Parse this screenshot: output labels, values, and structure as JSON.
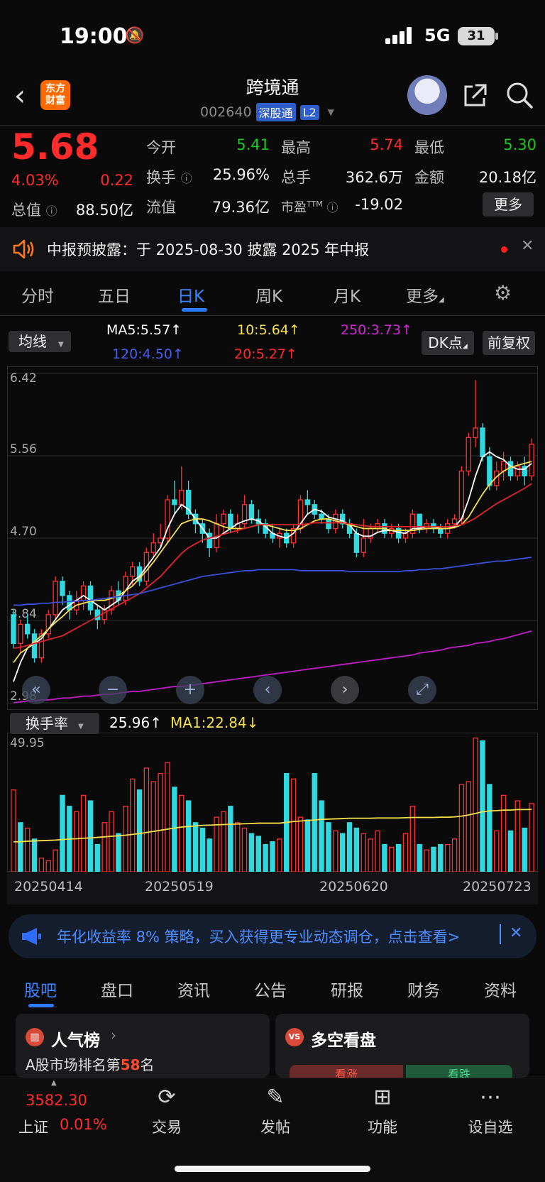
{
  "status_bar": {
    "time": "19:00",
    "network": "5G",
    "battery": "31"
  },
  "header": {
    "logo_line1": "东方",
    "logo_line2": "财富",
    "name": "跨境通",
    "code": "002640",
    "exchange_tag": "深股通",
    "level_tag": "L2"
  },
  "quote": {
    "price": "5.68",
    "change_pct": "4.03%",
    "change": "0.22",
    "fields": [
      {
        "label": "今开",
        "value": "5.41",
        "color": "#1ec81e"
      },
      {
        "label": "最高",
        "value": "5.74",
        "color": "#ff2b2b"
      },
      {
        "label": "最低",
        "value": "5.30",
        "color": "#1ec81e"
      },
      {
        "label": "换手",
        "value": "25.96%",
        "color": "#f2f2f2"
      },
      {
        "label": "总手",
        "value": "362.6万",
        "color": "#f2f2f2"
      },
      {
        "label": "金额",
        "value": "20.18亿",
        "color": "#f2f2f2"
      },
      {
        "label": "总值",
        "value": "88.50亿",
        "color": "#f2f2f2"
      },
      {
        "label": "流值",
        "value": "79.36亿",
        "color": "#f2f2f2"
      },
      {
        "label": "市盈",
        "value": "-19.02",
        "color": "#f2f2f2"
      }
    ],
    "pe_superscript": "TTM",
    "more_label": "更多"
  },
  "notice": {
    "text": "中报预披露：于 2025-08-30 披露 2025 年中报"
  },
  "period_tabs": [
    "分时",
    "五日",
    "日K",
    "周K",
    "月K",
    "更多"
  ],
  "active_period": "日K",
  "indicators": {
    "ma_selector": "均线",
    "ma5": "MA5:5.57",
    "ma10": "10:5.64",
    "ma250": "250:3.73",
    "ma120": "120:4.50",
    "ma20": "20:5.27",
    "dk_label": "DK点",
    "adjust_label": "前复权",
    "colors": {
      "ma5": "#ffffff",
      "ma10": "#f5e14a",
      "ma20": "#e0242c",
      "ma120": "#3b4fd6",
      "ma250": "#c21cc8"
    }
  },
  "chart_data": [
    {
      "type": "candlestick",
      "title": "",
      "y_ticks": [
        "6.42",
        "5.56",
        "4.70",
        "3.84",
        "2.98"
      ],
      "ylim": [
        2.98,
        6.42
      ],
      "candles": [
        [
          3.9,
          3.6,
          3.95,
          3.55
        ],
        [
          3.6,
          3.8,
          3.85,
          3.5
        ],
        [
          3.8,
          3.7,
          3.9,
          3.65
        ],
        [
          3.7,
          3.45,
          3.75,
          3.4
        ],
        [
          3.45,
          3.7,
          3.75,
          3.4
        ],
        [
          3.7,
          3.9,
          3.95,
          3.65
        ],
        [
          3.9,
          4.25,
          4.3,
          3.85
        ],
        [
          4.25,
          4.1,
          4.3,
          4.0
        ],
        [
          4.1,
          3.95,
          4.15,
          3.85
        ],
        [
          3.95,
          4.05,
          4.15,
          3.9
        ],
        [
          4.05,
          4.2,
          4.25,
          3.95
        ],
        [
          4.2,
          3.95,
          4.25,
          3.9
        ],
        [
          3.95,
          3.85,
          4.0,
          3.75
        ],
        [
          3.85,
          3.95,
          4.0,
          3.8
        ],
        [
          3.95,
          4.15,
          4.2,
          3.9
        ],
        [
          4.15,
          4.05,
          4.25,
          4.0
        ],
        [
          4.05,
          4.3,
          4.35,
          4.0
        ],
        [
          4.3,
          4.4,
          4.45,
          4.2
        ],
        [
          4.4,
          4.25,
          4.45,
          4.2
        ],
        [
          4.25,
          4.55,
          4.6,
          4.2
        ],
        [
          4.55,
          4.65,
          4.75,
          4.5
        ],
        [
          4.65,
          4.7,
          4.85,
          4.6
        ],
        [
          4.7,
          5.1,
          5.15,
          4.65
        ],
        [
          5.1,
          5.05,
          5.3,
          4.95
        ],
        [
          5.05,
          5.2,
          5.45,
          5.0
        ],
        [
          5.2,
          4.95,
          5.3,
          4.9
        ],
        [
          4.95,
          4.85,
          5.0,
          4.75
        ],
        [
          4.85,
          4.75,
          4.9,
          4.65
        ],
        [
          4.75,
          4.6,
          4.8,
          4.5
        ],
        [
          4.6,
          4.85,
          4.95,
          4.55
        ],
        [
          4.85,
          4.95,
          5.0,
          4.75
        ],
        [
          4.95,
          4.8,
          5.0,
          4.75
        ],
        [
          4.8,
          4.85,
          4.95,
          4.75
        ],
        [
          4.85,
          5.05,
          5.15,
          4.8
        ],
        [
          5.05,
          4.9,
          5.1,
          4.85
        ],
        [
          4.9,
          4.85,
          5.0,
          4.75
        ],
        [
          4.85,
          4.75,
          4.9,
          4.7
        ],
        [
          4.75,
          4.7,
          4.85,
          4.65
        ],
        [
          4.7,
          4.75,
          4.8,
          4.6
        ],
        [
          4.75,
          4.65,
          4.8,
          4.6
        ],
        [
          4.65,
          4.8,
          4.85,
          4.6
        ],
        [
          4.8,
          5.1,
          5.15,
          4.75
        ],
        [
          5.1,
          5.05,
          5.2,
          4.95
        ],
        [
          5.05,
          4.95,
          5.1,
          4.9
        ],
        [
          4.95,
          4.9,
          5.0,
          4.85
        ],
        [
          4.9,
          4.8,
          4.95,
          4.75
        ],
        [
          4.8,
          4.95,
          5.0,
          4.75
        ],
        [
          4.95,
          4.85,
          5.0,
          4.8
        ],
        [
          4.85,
          4.75,
          4.9,
          4.7
        ],
        [
          4.75,
          4.55,
          4.8,
          4.5
        ],
        [
          4.55,
          4.7,
          4.9,
          4.5
        ],
        [
          4.7,
          4.8,
          4.85,
          4.65
        ],
        [
          4.8,
          4.85,
          4.9,
          4.75
        ],
        [
          4.85,
          4.75,
          4.9,
          4.7
        ],
        [
          4.75,
          4.8,
          4.85,
          4.7
        ],
        [
          4.8,
          4.7,
          4.85,
          4.65
        ],
        [
          4.7,
          4.75,
          4.8,
          4.65
        ],
        [
          4.75,
          4.95,
          5.0,
          4.7
        ],
        [
          4.95,
          4.8,
          4.95,
          4.75
        ],
        [
          4.8,
          4.85,
          4.9,
          4.75
        ],
        [
          4.85,
          4.8,
          4.9,
          4.75
        ],
        [
          4.8,
          4.75,
          4.85,
          4.7
        ],
        [
          4.75,
          4.85,
          4.9,
          4.7
        ],
        [
          4.85,
          4.9,
          4.95,
          4.8
        ],
        [
          4.9,
          5.4,
          5.45,
          4.85
        ],
        [
          5.4,
          5.75,
          5.8,
          5.35
        ],
        [
          5.75,
          5.85,
          6.35,
          5.65
        ],
        [
          5.85,
          5.55,
          5.9,
          5.5
        ],
        [
          5.55,
          5.25,
          5.65,
          5.2
        ],
        [
          5.25,
          5.4,
          5.5,
          5.2
        ],
        [
          5.4,
          5.5,
          5.6,
          5.3
        ],
        [
          5.5,
          5.35,
          5.55,
          5.3
        ],
        [
          5.35,
          5.45,
          5.5,
          5.3
        ],
        [
          5.45,
          5.35,
          5.55,
          5.25
        ],
        [
          5.35,
          5.68,
          5.74,
          5.3
        ]
      ],
      "series": [
        {
          "name": "MA5",
          "color": "#ffffff",
          "values": [
            3.2,
            3.4,
            3.55,
            3.6,
            3.65,
            3.75,
            3.85,
            3.95,
            4.0,
            4.05,
            4.1,
            4.05,
            4.0,
            3.95,
            4.0,
            4.05,
            4.15,
            4.25,
            4.3,
            4.4,
            4.5,
            4.6,
            4.8,
            4.95,
            5.05,
            5.0,
            4.9,
            4.8,
            4.7,
            4.7,
            4.75,
            4.8,
            4.85,
            4.88,
            4.9,
            4.88,
            4.82,
            4.75,
            4.72,
            4.7,
            4.75,
            4.85,
            4.95,
            5.0,
            4.98,
            4.92,
            4.9,
            4.88,
            4.84,
            4.75,
            4.72,
            4.72,
            4.76,
            4.78,
            4.78,
            4.76,
            4.75,
            4.8,
            4.8,
            4.82,
            4.82,
            4.8,
            4.8,
            4.82,
            4.9,
            5.1,
            5.35,
            5.55,
            5.6,
            5.55,
            5.52,
            5.45,
            5.42,
            5.42,
            5.48
          ]
        },
        {
          "name": "MA10",
          "color": "#f5e14a",
          "values": [
            3.4,
            3.5,
            3.55,
            3.62,
            3.68,
            3.75,
            3.82,
            3.88,
            3.95,
            4.0,
            4.02,
            4.04,
            4.05,
            4.05,
            4.07,
            4.1,
            4.15,
            4.2,
            4.28,
            4.36,
            4.45,
            4.55,
            4.65,
            4.75,
            4.85,
            4.88,
            4.9,
            4.9,
            4.88,
            4.85,
            4.82,
            4.8,
            4.8,
            4.8,
            4.82,
            4.84,
            4.84,
            4.82,
            4.8,
            4.78,
            4.78,
            4.8,
            4.84,
            4.88,
            4.9,
            4.9,
            4.88,
            4.86,
            4.84,
            4.82,
            4.8,
            4.8,
            4.8,
            4.8,
            4.78,
            4.78,
            4.78,
            4.78,
            4.79,
            4.8,
            4.8,
            4.8,
            4.8,
            4.81,
            4.84,
            4.92,
            5.04,
            5.16,
            5.26,
            5.34,
            5.4,
            5.44,
            5.46,
            5.48,
            5.5
          ]
        },
        {
          "name": "MA20",
          "color": "#e0242c",
          "values": [
            3.55,
            3.56,
            3.58,
            3.6,
            3.62,
            3.64,
            3.66,
            3.68,
            3.72,
            3.76,
            3.8,
            3.84,
            3.88,
            3.92,
            3.96,
            4.0,
            4.04,
            4.08,
            4.12,
            4.18,
            4.24,
            4.3,
            4.38,
            4.46,
            4.54,
            4.6,
            4.64,
            4.68,
            4.7,
            4.72,
            4.74,
            4.76,
            4.78,
            4.8,
            4.82,
            4.84,
            4.84,
            4.84,
            4.84,
            4.84,
            4.84,
            4.84,
            4.85,
            4.86,
            4.86,
            4.86,
            4.86,
            4.86,
            4.85,
            4.84,
            4.83,
            4.82,
            4.82,
            4.82,
            4.82,
            4.82,
            4.82,
            4.82,
            4.82,
            4.82,
            4.82,
            4.82,
            4.82,
            4.83,
            4.84,
            4.87,
            4.91,
            4.96,
            5.01,
            5.06,
            5.1,
            5.14,
            5.18,
            5.22,
            5.27
          ]
        },
        {
          "name": "MA120",
          "color": "#3b4fd6",
          "values": [
            4.0,
            4.0,
            4.01,
            4.01,
            4.02,
            4.02,
            4.03,
            4.03,
            4.04,
            4.04,
            4.05,
            4.05,
            4.06,
            4.07,
            4.08,
            4.09,
            4.1,
            4.11,
            4.12,
            4.14,
            4.16,
            4.18,
            4.2,
            4.22,
            4.24,
            4.26,
            4.28,
            4.3,
            4.31,
            4.32,
            4.33,
            4.34,
            4.35,
            4.36,
            4.36,
            4.37,
            4.37,
            4.37,
            4.37,
            4.37,
            4.37,
            4.36,
            4.36,
            4.36,
            4.36,
            4.36,
            4.36,
            4.36,
            4.35,
            4.35,
            4.35,
            4.35,
            4.35,
            4.35,
            4.35,
            4.35,
            4.36,
            4.36,
            4.37,
            4.37,
            4.38,
            4.38,
            4.39,
            4.4,
            4.41,
            4.42,
            4.43,
            4.44,
            4.45,
            4.46,
            4.46,
            4.47,
            4.48,
            4.49,
            4.5
          ]
        },
        {
          "name": "MA250",
          "color": "#c21cc8",
          "values": [
            2.98,
            2.99,
            3.0,
            3.0,
            3.01,
            3.01,
            3.02,
            3.03,
            3.03,
            3.04,
            3.05,
            3.05,
            3.06,
            3.07,
            3.07,
            3.08,
            3.09,
            3.1,
            3.1,
            3.11,
            3.12,
            3.13,
            3.14,
            3.15,
            3.15,
            3.16,
            3.17,
            3.18,
            3.19,
            3.2,
            3.21,
            3.22,
            3.23,
            3.24,
            3.25,
            3.26,
            3.27,
            3.28,
            3.29,
            3.3,
            3.31,
            3.32,
            3.33,
            3.34,
            3.35,
            3.36,
            3.37,
            3.38,
            3.39,
            3.4,
            3.41,
            3.42,
            3.43,
            3.44,
            3.45,
            3.46,
            3.47,
            3.48,
            3.5,
            3.51,
            3.52,
            3.53,
            3.55,
            3.56,
            3.57,
            3.58,
            3.6,
            3.61,
            3.62,
            3.64,
            3.65,
            3.67,
            3.69,
            3.71,
            3.73
          ]
        }
      ]
    },
    {
      "type": "bar",
      "title": "换手率",
      "y_ticks": [
        "49.95"
      ],
      "ylim": [
        0,
        49.95
      ],
      "x_tick_labels": [
        "20250414",
        "20250519",
        "20250620",
        "20250723"
      ],
      "values": [
        30,
        18,
        16,
        12,
        5,
        4,
        8,
        28,
        24,
        22,
        28,
        26,
        10,
        18,
        22,
        14,
        24,
        34,
        30,
        38,
        33,
        36,
        40,
        31,
        28,
        26,
        18,
        16,
        12,
        20,
        22,
        24,
        18,
        16,
        14,
        13,
        10,
        11,
        12,
        36,
        34,
        20,
        19,
        36,
        26,
        18,
        15,
        14,
        18,
        16,
        14,
        12,
        15,
        10,
        9,
        10,
        14,
        24,
        10,
        8,
        9,
        10,
        10,
        12,
        32,
        33,
        49,
        48,
        32,
        15,
        28,
        15,
        26,
        16,
        25
      ],
      "up": [
        1,
        0,
        1,
        0,
        1,
        1,
        1,
        0,
        0,
        1,
        1,
        0,
        0,
        1,
        1,
        0,
        1,
        1,
        0,
        1,
        1,
        1,
        1,
        0,
        1,
        0,
        0,
        0,
        0,
        1,
        1,
        0,
        1,
        1,
        0,
        0,
        0,
        0,
        1,
        0,
        1,
        1,
        0,
        0,
        0,
        0,
        1,
        0,
        0,
        0,
        1,
        1,
        1,
        0,
        1,
        0,
        1,
        1,
        0,
        1,
        0,
        0,
        1,
        1,
        1,
        1,
        1,
        0,
        0,
        1,
        1,
        0,
        1,
        0,
        1
      ],
      "ma_series": {
        "name": "MA1",
        "color": "#f5e14a",
        "values": [
          11,
          11,
          11.2,
          11.3,
          11.4,
          11.5,
          11.6,
          11.8,
          12,
          12.1,
          12.3,
          12.4,
          12.6,
          12.8,
          13,
          13.2,
          13.4,
          13.7,
          14,
          14.4,
          14.8,
          15.2,
          15.6,
          16,
          16.4,
          16.6,
          16.8,
          17,
          17.1,
          17.2,
          17.3,
          17.4,
          17.5,
          17.6,
          17.7,
          17.8,
          17.8,
          17.8,
          17.8,
          18.1,
          18.4,
          18.6,
          18.8,
          19,
          19.2,
          19.3,
          19.4,
          19.5,
          19.6,
          19.6,
          19.6,
          19.6,
          19.7,
          19.7,
          19.7,
          19.7,
          19.8,
          19.9,
          19.9,
          19.9,
          19.9,
          20,
          20,
          20.1,
          20.4,
          20.8,
          21.4,
          22,
          22.3,
          22.4,
          22.6,
          22.6,
          22.8,
          22.8,
          22.84
        ]
      },
      "turnover_label": "25.96",
      "ma1_label": "MA1:22.84"
    }
  ],
  "ad": {
    "text": "年化收益率 8% 策略，买入获得更专业动态调仓，点击查看>"
  },
  "bottom_tabs": [
    "股吧",
    "盘口",
    "资讯",
    "公告",
    "研报",
    "财务",
    "资料"
  ],
  "active_bottom_tab": "股吧",
  "cards": {
    "left_title": "人气榜",
    "left_sub_prefix": "A股市场排名第",
    "left_rank": "58",
    "left_sub_suffix": "名",
    "right_title": "多空看盘",
    "right_badge": "VS",
    "bull": "看涨",
    "bear": "看跌"
  },
  "bottom_nav": {
    "index_value": "3582.30",
    "index_name": "上证",
    "index_change": "0.01%",
    "items": [
      {
        "label": "交易",
        "icon": "yen-swap-icon"
      },
      {
        "label": "发帖",
        "icon": "edit-icon"
      },
      {
        "label": "功能",
        "icon": "apps-icon"
      },
      {
        "label": "设自选",
        "icon": "more-icon"
      }
    ]
  }
}
